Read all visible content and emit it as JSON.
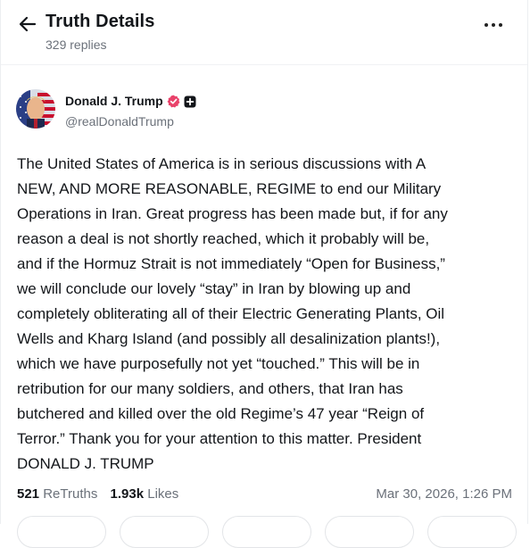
{
  "header": {
    "title": "Truth Details",
    "replies": "329 replies",
    "back_icon": "arrow-left-icon",
    "more_icon": "more-horizontal-icon"
  },
  "author": {
    "name": "Donald J. Trump",
    "handle": "@realDonaldTrump",
    "verified_color": "#e9426a",
    "badge_icon": "plus-badge-icon"
  },
  "post": {
    "body": "The United States of America is in serious discussions with A\nNEW, AND MORE REASONABLE, REGIME to end our Military\nOperations in Iran. Great progress has been made but, if for any\nreason a deal is not shortly reached, which it probably will be,\nand if the Hormuz Strait is not immediately “Open for Business,”\nwe will conclude our lovely “stay” in Iran by blowing up and\ncompletely obliterating all of their Electric Generating Plants, Oil\nWells and Kharg Island (and possibly all desalinization plants!),\nwhich we have purposefully not yet “touched.” This will be in\nretribution for our many soldiers, and others, that Iran has\nbutchered and killed over the old Regime’s 47 year “Reign of\nTerror.” Thank you for your attention to this matter. President\nDONALD J. TRUMP"
  },
  "stats": {
    "retruths_count": "521",
    "retruths_label": "ReTruths",
    "likes_count": "1.93k",
    "likes_label": "Likes",
    "timestamp": "Mar 30, 2026, 1:26 PM"
  },
  "colors": {
    "text": "#13161a",
    "muted": "#6b717a",
    "border": "#e3e5e8"
  }
}
